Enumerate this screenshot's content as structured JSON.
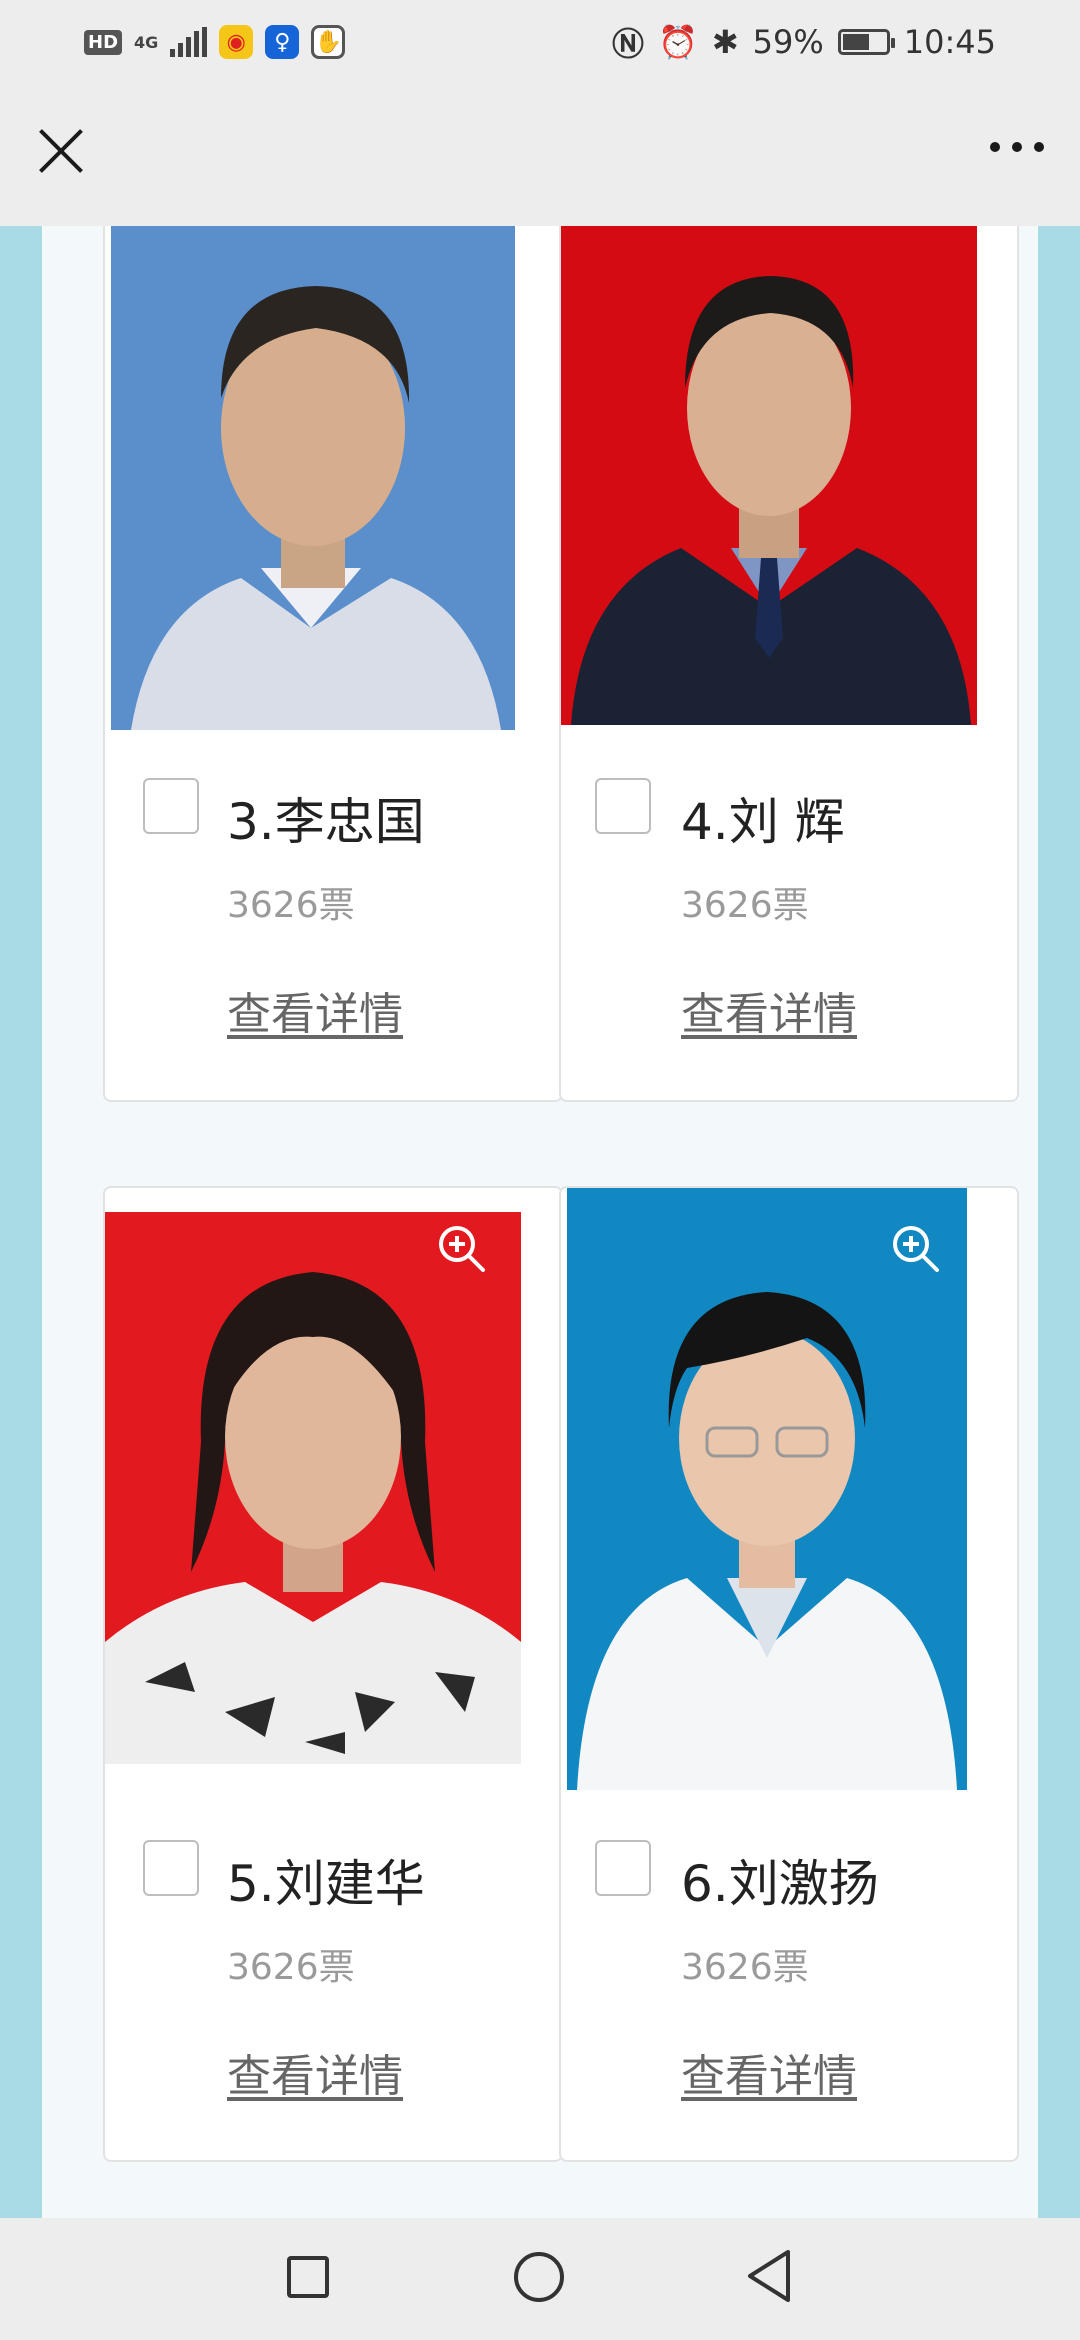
{
  "status_bar": {
    "hd_label": "HD",
    "network": "4G",
    "battery_percent": "59%",
    "time": "10:45",
    "icons": [
      "hd-icon",
      "signal-icon",
      "weibo-icon",
      "bulb-app-icon",
      "hand-app-icon",
      "nfc-icon",
      "alarm-icon",
      "bluetooth-icon",
      "battery-icon"
    ]
  },
  "title_bar": {
    "icons": [
      "close-icon",
      "more-icon"
    ]
  },
  "candidates": [
    {
      "name": "3.李忠国",
      "votes": "3626票",
      "detail": "查看详情",
      "photo_bg": "#5b8fcc",
      "outfit": "#d9dde8"
    },
    {
      "name": "4.刘 辉",
      "votes": "3626票",
      "detail": "查看详情",
      "photo_bg": "#d40b12",
      "outfit": "#1b2233"
    },
    {
      "name": "5.刘建华",
      "votes": "3626票",
      "detail": "查看详情",
      "photo_bg": "#e21a1f",
      "outfit": "#eeeeee"
    },
    {
      "name": "6.刘激扬",
      "votes": "3626票",
      "detail": "查看详情",
      "photo_bg": "#1188c2",
      "outfit": "#f4f6f8"
    }
  ],
  "nav_bar": {
    "icons": [
      "recent-apps-icon",
      "home-icon",
      "back-icon"
    ]
  },
  "colors": {
    "page_bg": "#a9dbe7",
    "panel_bg": "#f3f8fa",
    "bar_bg": "#ededed"
  }
}
